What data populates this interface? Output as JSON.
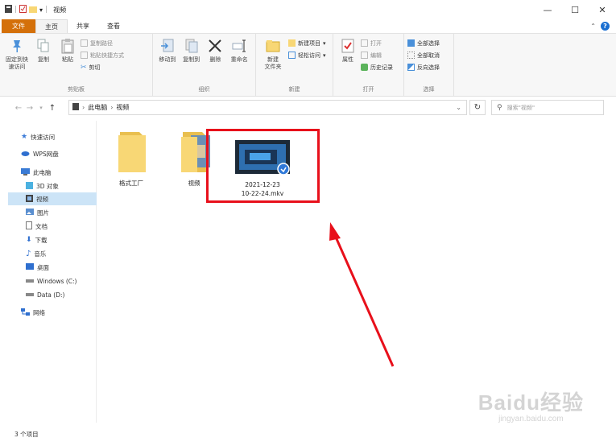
{
  "window": {
    "title": "视频",
    "controls": {
      "minimize": "—",
      "maximize": "☐",
      "close": "✕"
    }
  },
  "tabs": [
    {
      "label": "文件"
    },
    {
      "label": "主页"
    },
    {
      "label": "共享"
    },
    {
      "label": "查看"
    }
  ],
  "ribbon": {
    "clipboard": {
      "label": "剪贴板",
      "pin": "固定到快\n速访问",
      "copy": "复制",
      "paste": "粘贴",
      "copy_path": "复制路径",
      "paste_shortcut": "粘贴快捷方式",
      "cut": "剪切"
    },
    "organize": {
      "label": "组织",
      "move_to": "移动到",
      "copy_to": "复制到",
      "delete": "删除",
      "rename": "重命名"
    },
    "new": {
      "label": "新建",
      "new_folder": "新建\n文件夹",
      "new_item": "新建项目",
      "easy_access": "轻松访问"
    },
    "open": {
      "label": "打开",
      "properties": "属性",
      "open": "打开",
      "edit": "编辑",
      "history": "历史记录"
    },
    "select": {
      "label": "选择",
      "select_all": "全部选择",
      "select_none": "全部取消",
      "invert": "反向选择"
    }
  },
  "address": {
    "crumbs": [
      "此电脑",
      "视频"
    ],
    "search_placeholder": "搜索\"视频\""
  },
  "nav": {
    "quick_access": "快速访问",
    "wps": "WPS网盘",
    "this_pc": "此电脑",
    "objects3d": "3D 对象",
    "videos": "视频",
    "pictures": "图片",
    "documents": "文档",
    "downloads": "下载",
    "music": "音乐",
    "desktop": "桌面",
    "drive_c": "Windows (C:)",
    "drive_d": "Data (D:)",
    "network": "网络"
  },
  "files": [
    {
      "name": "格式工厂",
      "type": "folder"
    },
    {
      "name": "视频",
      "type": "folder"
    },
    {
      "name": "2021-12-23\n10-22-24.mkv",
      "type": "video"
    }
  ],
  "status": {
    "count": "3 个项目"
  },
  "watermark": {
    "brand": "Baidu经验",
    "url": "jingyan.baidu.com"
  },
  "colors": {
    "file_tab": "#d4700a",
    "highlight_box": "#e8101b",
    "arrow": "#e8101b",
    "selection": "#cce4f7",
    "folder": "#f8d775"
  }
}
